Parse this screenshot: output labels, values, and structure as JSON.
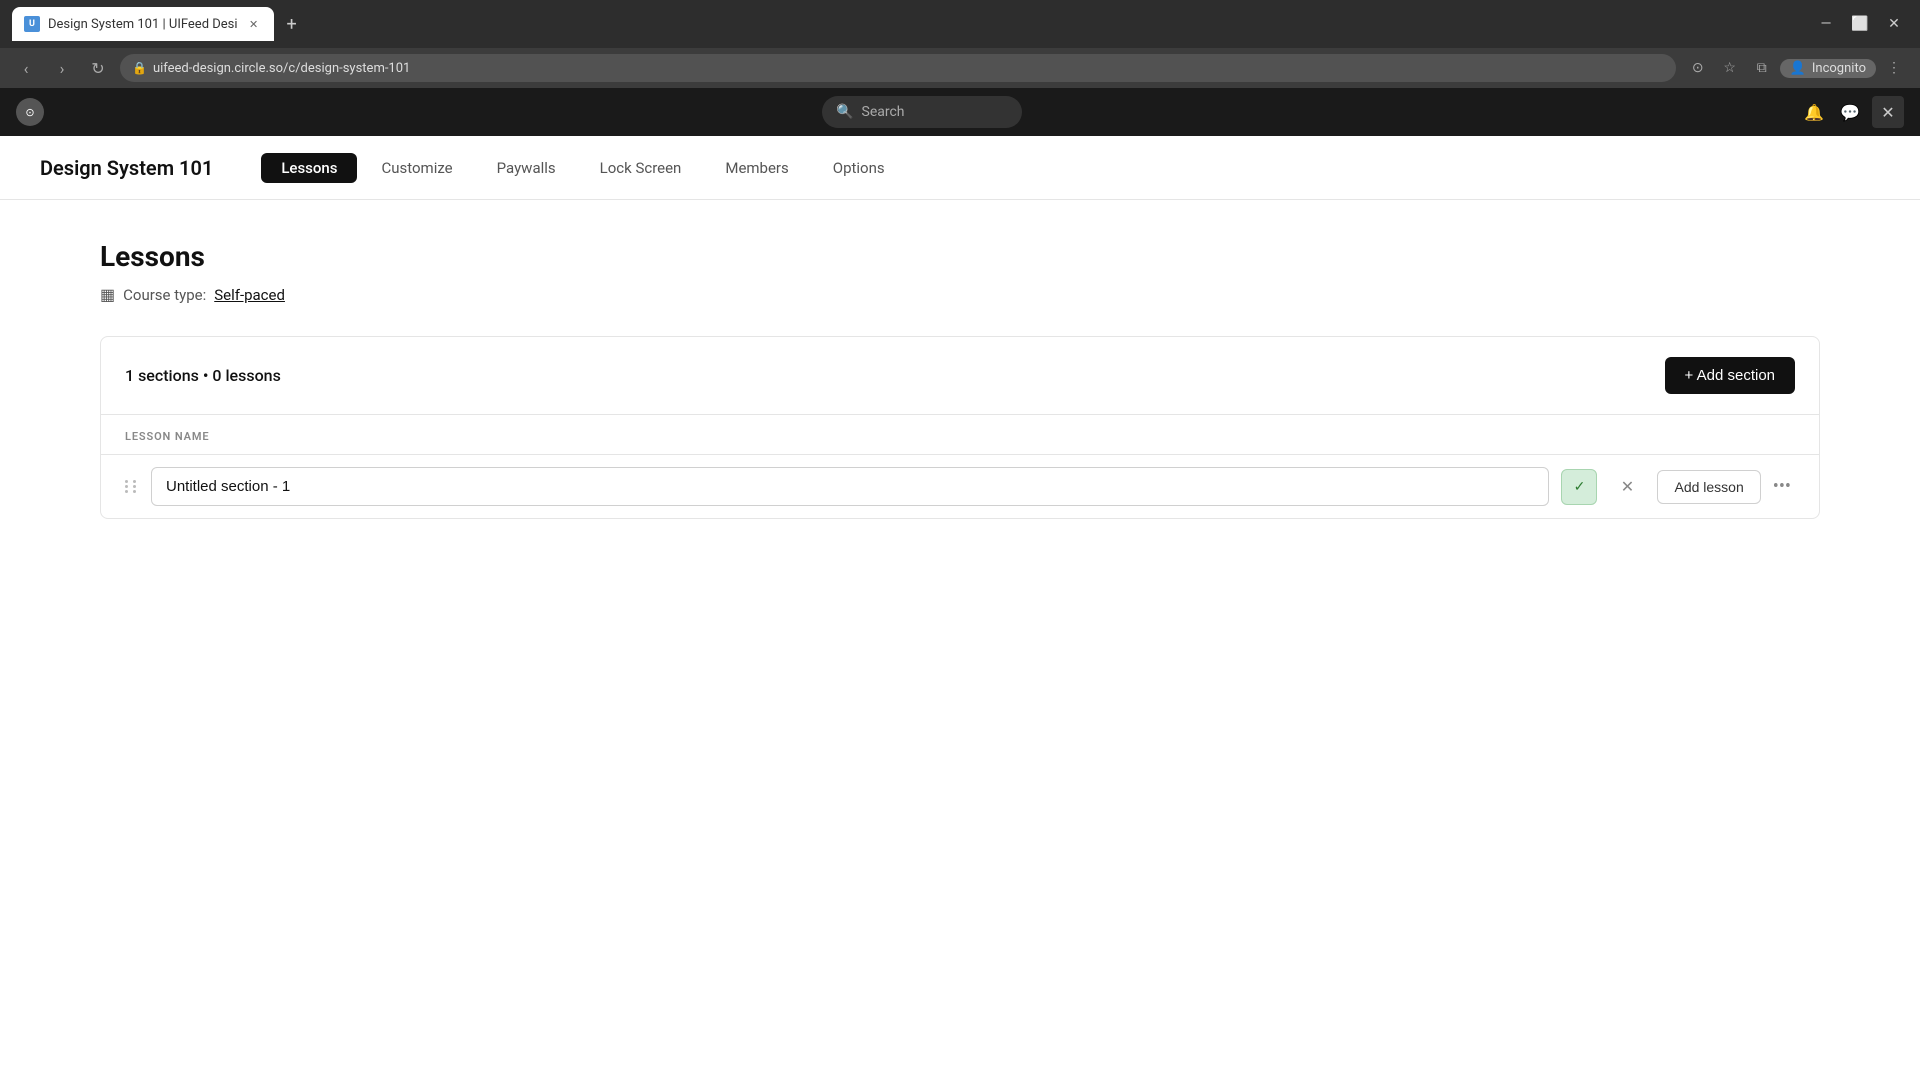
{
  "browser": {
    "tab_title": "Design System 101 | UIFeed Desi",
    "tab_favicon_text": "U",
    "address": "uifeed-design.circle.so/c/design-system-101",
    "incognito_label": "Incognito"
  },
  "app_header": {
    "search_placeholder": "Search",
    "close_icon": "✕"
  },
  "course": {
    "title": "Design System 101",
    "nav_tabs": [
      {
        "id": "lessons",
        "label": "Lessons",
        "active": true
      },
      {
        "id": "customize",
        "label": "Customize",
        "active": false
      },
      {
        "id": "paywalls",
        "label": "Paywalls",
        "active": false
      },
      {
        "id": "lock-screen",
        "label": "Lock Screen",
        "active": false
      },
      {
        "id": "members",
        "label": "Members",
        "active": false
      },
      {
        "id": "options",
        "label": "Options",
        "active": false
      }
    ]
  },
  "lessons_page": {
    "title": "Lessons",
    "course_type_label": "Course type:",
    "course_type_value": "Self-paced",
    "sections_count": "1 sections • 0 lessons",
    "add_section_label": "+ Add section",
    "column_header": "LESSON NAME",
    "section_input_value": "Untitled section - 1",
    "add_lesson_label": "Add lesson"
  }
}
